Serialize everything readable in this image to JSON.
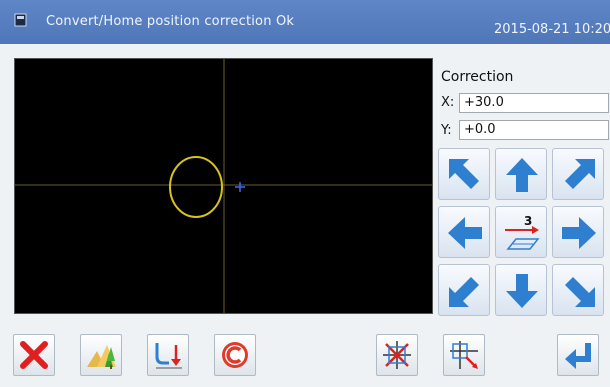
{
  "titlebar": {
    "title": "Convert/Home position correction Ok",
    "datetime": "2015-08-21 10:20"
  },
  "correction": {
    "heading": "Correction",
    "x_label": "X:",
    "x_value": "+30.0",
    "y_label": "Y:",
    "y_value": "+0.0"
  },
  "move_step": {
    "value": "3"
  },
  "colors": {
    "titlebar": "#5a82c2",
    "pattern": "#d8c21e",
    "crosshair": "#6b5a2e",
    "arrow": "#2f7fd0",
    "cancel": "#e02020"
  },
  "icons": [
    "document-icon",
    "arrow-up-left-icon",
    "arrow-up-icon",
    "arrow-up-right-icon",
    "arrow-left-icon",
    "step-size-icon",
    "arrow-right-icon",
    "arrow-down-left-icon",
    "arrow-down-icon",
    "arrow-down-right-icon",
    "close-icon",
    "landscape-icon",
    "return-path-icon",
    "copyright-icon",
    "cross-origin-icon",
    "origin-select-icon",
    "enter-icon"
  ]
}
